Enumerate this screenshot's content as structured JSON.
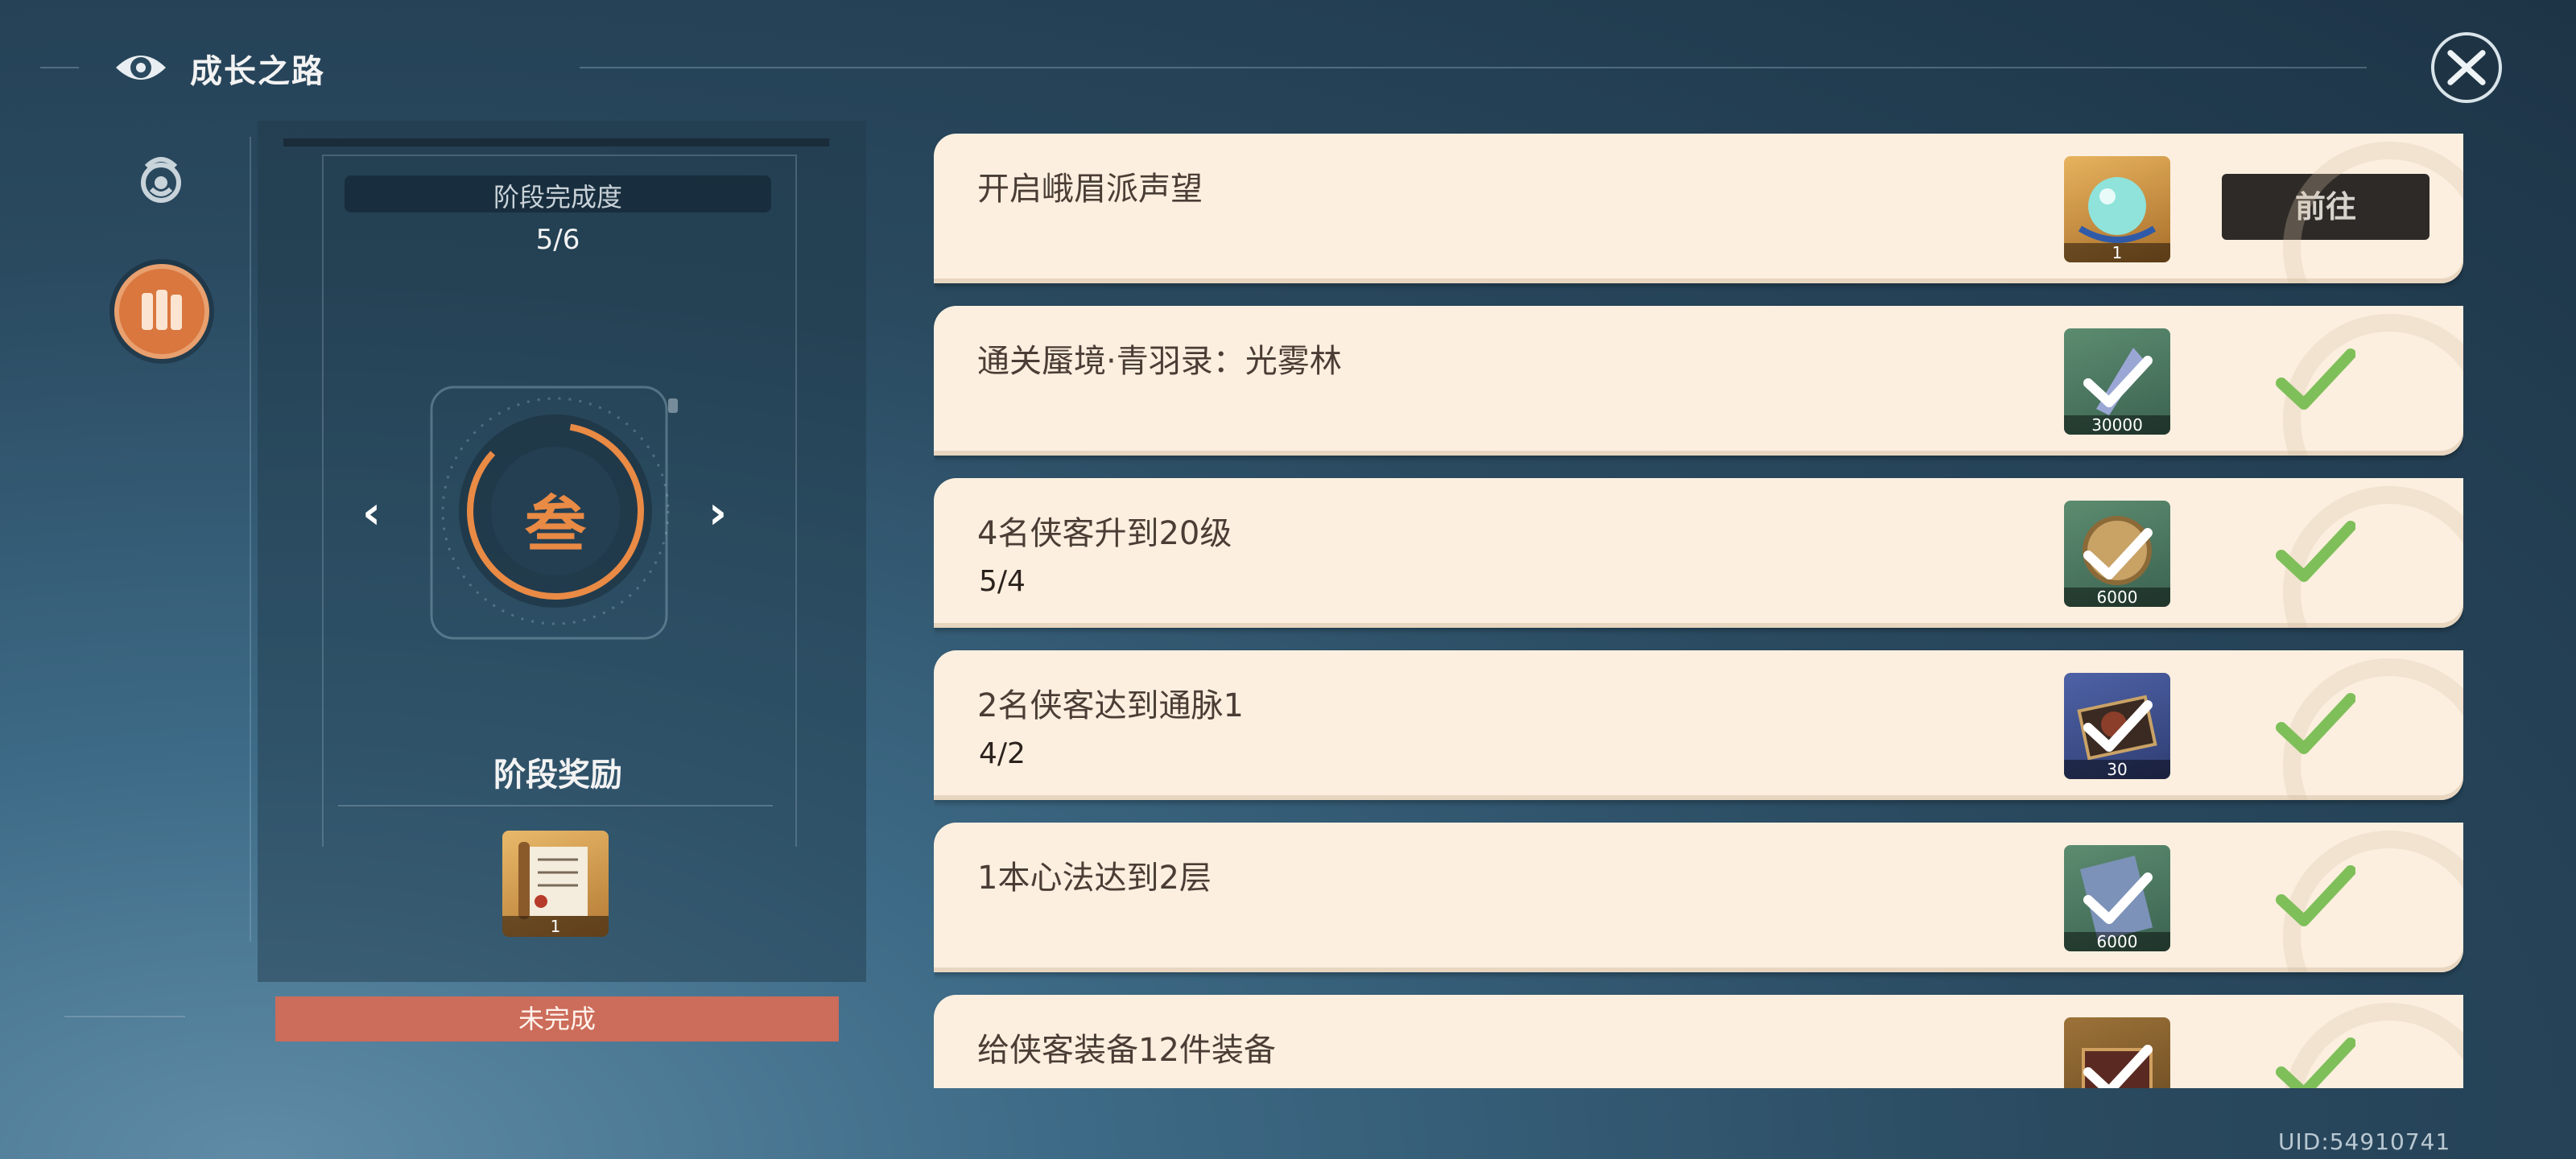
{
  "header": {
    "title": "成长之路"
  },
  "stage": {
    "completion_label": "阶段完成度",
    "completion_value": "5/6",
    "stage_char": "叁",
    "reward_title": "阶段奖励",
    "reward_count": "1",
    "status": "未完成"
  },
  "tasks": [
    {
      "title": "开启峨眉派声望",
      "progress": "",
      "count": "1",
      "action": "前往",
      "item_color": "#c9913f"
    },
    {
      "title": "通关蜃境·青羽录：光雾林",
      "progress": "",
      "count": "30000",
      "item_color": "#4f7a62"
    },
    {
      "title": "4名侠客升到20级",
      "progress": "5/4",
      "count": "6000",
      "item_color": "#4f7a62"
    },
    {
      "title": "2名侠客达到通脉1",
      "progress": "4/2",
      "count": "30",
      "item_color": "#3d4f8c"
    },
    {
      "title": "1本心法达到2层",
      "progress": "",
      "count": "6000",
      "item_color": "#4f7a62"
    },
    {
      "title": "给侠客装备12件装备",
      "progress": "",
      "count": "",
      "item_color": "#8a6230"
    }
  ],
  "uid": "UID:54910741",
  "colors": {
    "accent_orange": "#e98a45",
    "status_red": "#cc6c5a",
    "check_green": "#7fbf5a"
  }
}
